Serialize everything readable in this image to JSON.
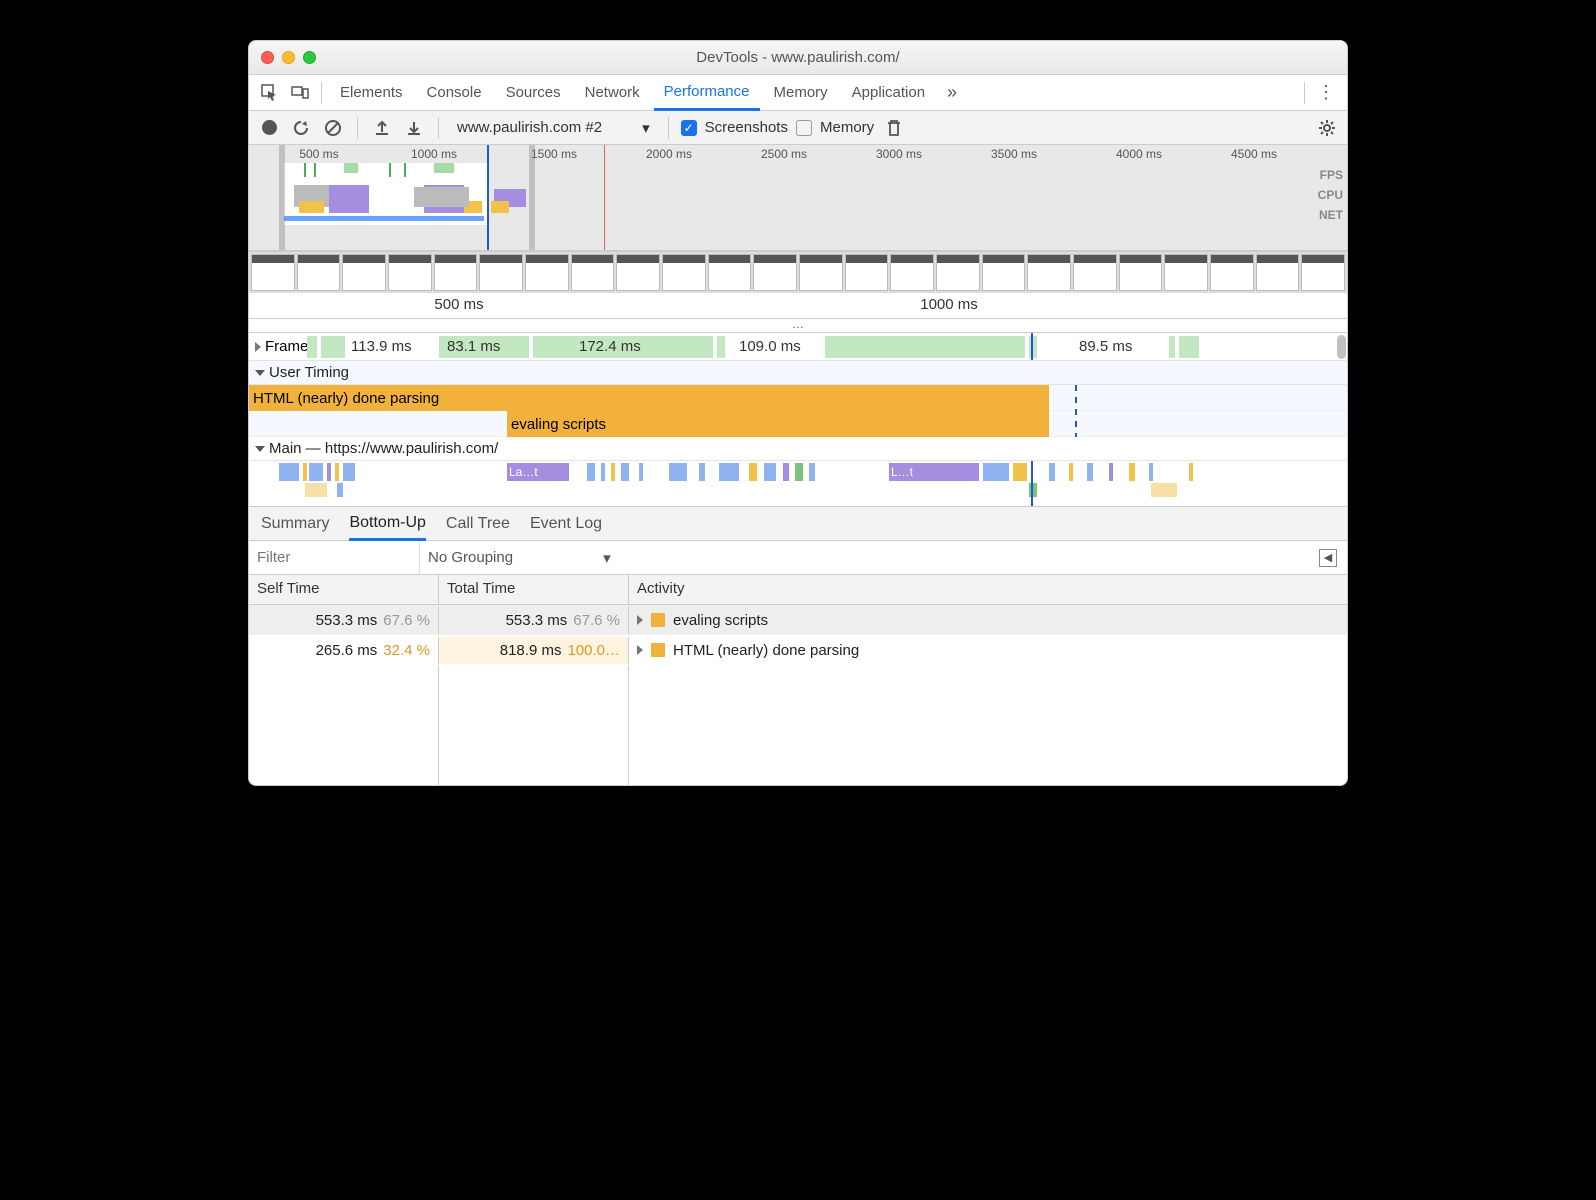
{
  "window": {
    "title": "DevTools - www.paulirish.com/"
  },
  "tabs": {
    "items": [
      "Elements",
      "Console",
      "Sources",
      "Network",
      "Performance",
      "Memory",
      "Application"
    ],
    "active": "Performance"
  },
  "toolbar": {
    "recording_label": "www.paulirish.com #2",
    "screenshots_label": "Screenshots",
    "screenshots_checked": true,
    "memory_label": "Memory",
    "memory_checked": false
  },
  "overview": {
    "ticks": [
      "500 ms",
      "1000 ms",
      "1500 ms",
      "2000 ms",
      "2500 ms",
      "3000 ms",
      "3500 ms",
      "4000 ms",
      "4500 ms"
    ],
    "lane_labels": [
      "FPS",
      "CPU",
      "NET"
    ]
  },
  "detail_ruler": {
    "ticks": [
      "500 ms",
      "1000 ms"
    ]
  },
  "frames": {
    "label": "Frames",
    "items": [
      "113.9 ms",
      "83.1 ms",
      "172.4 ms",
      "109.0 ms",
      "89.5 ms"
    ]
  },
  "user_timing": {
    "label": "User Timing",
    "bars": [
      {
        "name": "HTML (nearly) done parsing"
      },
      {
        "name": "evaling scripts"
      }
    ]
  },
  "main_thread": {
    "label": "Main — https://www.paulirish.com/",
    "chips": [
      "La…t",
      "L…t"
    ]
  },
  "bottom_tabs": {
    "items": [
      "Summary",
      "Bottom-Up",
      "Call Tree",
      "Event Log"
    ],
    "active": "Bottom-Up"
  },
  "filter": {
    "placeholder": "Filter",
    "grouping": "No Grouping"
  },
  "table": {
    "headers": [
      "Self Time",
      "Total Time",
      "Activity"
    ],
    "rows": [
      {
        "self_ms": "553.3 ms",
        "self_pct": "67.6 %",
        "total_ms": "553.3 ms",
        "total_pct": "67.6 %",
        "activity": "evaling scripts"
      },
      {
        "self_ms": "265.6 ms",
        "self_pct": "32.4 %",
        "total_ms": "818.9 ms",
        "total_pct": "100.0…",
        "activity": "HTML (nearly) done parsing"
      }
    ]
  }
}
